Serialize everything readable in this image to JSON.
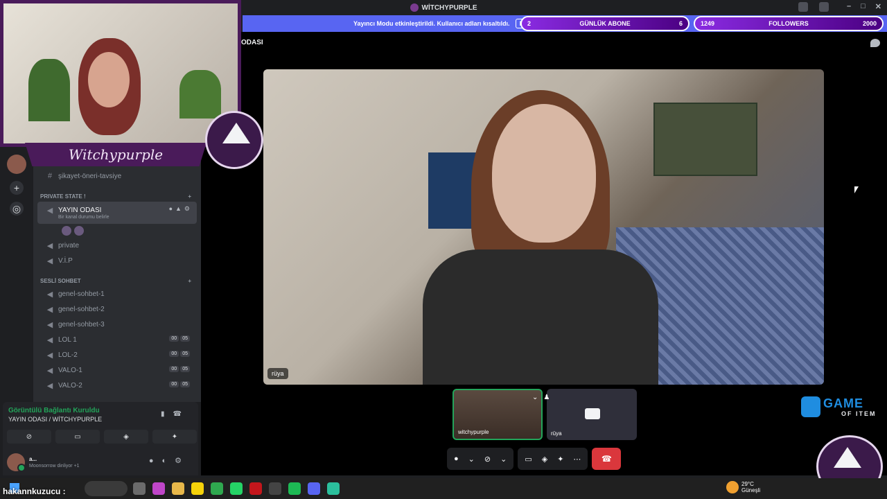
{
  "window": {
    "title": "WİTCHYPURPLE",
    "controls": [
      "–",
      "□",
      "✕"
    ]
  },
  "notice": {
    "message": "Yayıncı Modu etkinleştirildi. Kullanıcı adları kısaltıldı.",
    "button": "Dev"
  },
  "goals": [
    {
      "current": "2",
      "label": "GÜNLÜK ABONE",
      "target": "6"
    },
    {
      "current": "1249",
      "label": "FOLLOWERS",
      "target": "2000"
    }
  ],
  "overlay": {
    "streamer_name": "Witchypurple"
  },
  "sidebar": {
    "top_channel": "şikayet-öneri-tavsiye",
    "categories": [
      {
        "label": "PRIVATE STATE !"
      },
      {
        "label": "SESLİ SOHBET"
      }
    ],
    "active_channel": {
      "name": "YAYIN ODASI",
      "status": "Bir kanal durumu belirle"
    },
    "private_channels": [
      "private",
      "V.İ.P"
    ],
    "voice_channels": [
      {
        "name": "genel-sohbet-1"
      },
      {
        "name": "genel-sohbet-2"
      },
      {
        "name": "genel-sohbet-3"
      },
      {
        "name": "LOL 1",
        "a": "00",
        "b": "05"
      },
      {
        "name": "LOL-2",
        "a": "00",
        "b": "05"
      },
      {
        "name": "VALO-1",
        "a": "00",
        "b": "05"
      },
      {
        "name": "VALO-2",
        "a": "00",
        "b": "05"
      }
    ]
  },
  "voice_panel": {
    "status": "Görüntülü Bağlantı Kuruldu",
    "location": "YAYIN ODASI / WİTCHYPURPLE"
  },
  "user_panel": {
    "name": "a...",
    "activity": "Moonsorrow dinliyor +1"
  },
  "main": {
    "channel_header": "ODASI",
    "main_video_name": "rüya",
    "thumbnails": [
      {
        "name": "witchypurple"
      },
      {
        "name": "rüya"
      }
    ]
  },
  "brand": {
    "line1": "GAME",
    "line2": "OF ITEM"
  },
  "taskbar": {
    "temperature": "29°C",
    "weather_label": "Güneşli"
  },
  "subtitle": "hakannkuzucu :",
  "colors": {
    "discord_blurple": "#5865f2",
    "online_green": "#23a55a",
    "end_call_red": "#da373c",
    "overlay_purple": "#4a1b5a",
    "brand_blue": "#1f8de0"
  }
}
